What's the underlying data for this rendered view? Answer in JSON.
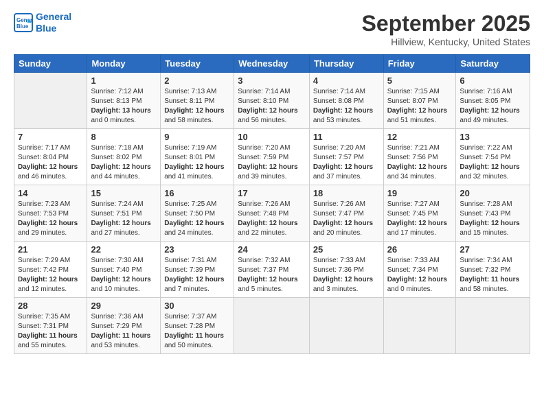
{
  "header": {
    "logo_line1": "General",
    "logo_line2": "Blue",
    "month": "September 2025",
    "location": "Hillview, Kentucky, United States"
  },
  "weekdays": [
    "Sunday",
    "Monday",
    "Tuesday",
    "Wednesday",
    "Thursday",
    "Friday",
    "Saturday"
  ],
  "weeks": [
    [
      {
        "day": "",
        "info": ""
      },
      {
        "day": "1",
        "info": "Sunrise: 7:12 AM\nSunset: 8:13 PM\nDaylight: 13 hours\nand 0 minutes."
      },
      {
        "day": "2",
        "info": "Sunrise: 7:13 AM\nSunset: 8:11 PM\nDaylight: 12 hours\nand 58 minutes."
      },
      {
        "day": "3",
        "info": "Sunrise: 7:14 AM\nSunset: 8:10 PM\nDaylight: 12 hours\nand 56 minutes."
      },
      {
        "day": "4",
        "info": "Sunrise: 7:14 AM\nSunset: 8:08 PM\nDaylight: 12 hours\nand 53 minutes."
      },
      {
        "day": "5",
        "info": "Sunrise: 7:15 AM\nSunset: 8:07 PM\nDaylight: 12 hours\nand 51 minutes."
      },
      {
        "day": "6",
        "info": "Sunrise: 7:16 AM\nSunset: 8:05 PM\nDaylight: 12 hours\nand 49 minutes."
      }
    ],
    [
      {
        "day": "7",
        "info": "Sunrise: 7:17 AM\nSunset: 8:04 PM\nDaylight: 12 hours\nand 46 minutes."
      },
      {
        "day": "8",
        "info": "Sunrise: 7:18 AM\nSunset: 8:02 PM\nDaylight: 12 hours\nand 44 minutes."
      },
      {
        "day": "9",
        "info": "Sunrise: 7:19 AM\nSunset: 8:01 PM\nDaylight: 12 hours\nand 41 minutes."
      },
      {
        "day": "10",
        "info": "Sunrise: 7:20 AM\nSunset: 7:59 PM\nDaylight: 12 hours\nand 39 minutes."
      },
      {
        "day": "11",
        "info": "Sunrise: 7:20 AM\nSunset: 7:57 PM\nDaylight: 12 hours\nand 37 minutes."
      },
      {
        "day": "12",
        "info": "Sunrise: 7:21 AM\nSunset: 7:56 PM\nDaylight: 12 hours\nand 34 minutes."
      },
      {
        "day": "13",
        "info": "Sunrise: 7:22 AM\nSunset: 7:54 PM\nDaylight: 12 hours\nand 32 minutes."
      }
    ],
    [
      {
        "day": "14",
        "info": "Sunrise: 7:23 AM\nSunset: 7:53 PM\nDaylight: 12 hours\nand 29 minutes."
      },
      {
        "day": "15",
        "info": "Sunrise: 7:24 AM\nSunset: 7:51 PM\nDaylight: 12 hours\nand 27 minutes."
      },
      {
        "day": "16",
        "info": "Sunrise: 7:25 AM\nSunset: 7:50 PM\nDaylight: 12 hours\nand 24 minutes."
      },
      {
        "day": "17",
        "info": "Sunrise: 7:26 AM\nSunset: 7:48 PM\nDaylight: 12 hours\nand 22 minutes."
      },
      {
        "day": "18",
        "info": "Sunrise: 7:26 AM\nSunset: 7:47 PM\nDaylight: 12 hours\nand 20 minutes."
      },
      {
        "day": "19",
        "info": "Sunrise: 7:27 AM\nSunset: 7:45 PM\nDaylight: 12 hours\nand 17 minutes."
      },
      {
        "day": "20",
        "info": "Sunrise: 7:28 AM\nSunset: 7:43 PM\nDaylight: 12 hours\nand 15 minutes."
      }
    ],
    [
      {
        "day": "21",
        "info": "Sunrise: 7:29 AM\nSunset: 7:42 PM\nDaylight: 12 hours\nand 12 minutes."
      },
      {
        "day": "22",
        "info": "Sunrise: 7:30 AM\nSunset: 7:40 PM\nDaylight: 12 hours\nand 10 minutes."
      },
      {
        "day": "23",
        "info": "Sunrise: 7:31 AM\nSunset: 7:39 PM\nDaylight: 12 hours\nand 7 minutes."
      },
      {
        "day": "24",
        "info": "Sunrise: 7:32 AM\nSunset: 7:37 PM\nDaylight: 12 hours\nand 5 minutes."
      },
      {
        "day": "25",
        "info": "Sunrise: 7:33 AM\nSunset: 7:36 PM\nDaylight: 12 hours\nand 3 minutes."
      },
      {
        "day": "26",
        "info": "Sunrise: 7:33 AM\nSunset: 7:34 PM\nDaylight: 12 hours\nand 0 minutes."
      },
      {
        "day": "27",
        "info": "Sunrise: 7:34 AM\nSunset: 7:32 PM\nDaylight: 11 hours\nand 58 minutes."
      }
    ],
    [
      {
        "day": "28",
        "info": "Sunrise: 7:35 AM\nSunset: 7:31 PM\nDaylight: 11 hours\nand 55 minutes."
      },
      {
        "day": "29",
        "info": "Sunrise: 7:36 AM\nSunset: 7:29 PM\nDaylight: 11 hours\nand 53 minutes."
      },
      {
        "day": "30",
        "info": "Sunrise: 7:37 AM\nSunset: 7:28 PM\nDaylight: 11 hours\nand 50 minutes."
      },
      {
        "day": "",
        "info": ""
      },
      {
        "day": "",
        "info": ""
      },
      {
        "day": "",
        "info": ""
      },
      {
        "day": "",
        "info": ""
      }
    ]
  ]
}
